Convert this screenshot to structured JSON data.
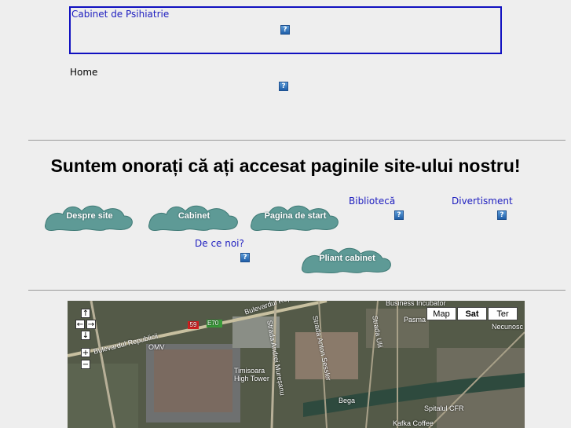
{
  "top": {
    "cabinet_link": "Cabinet de Psihiatrie",
    "home_link": "Home"
  },
  "headline": "Suntem onorați că ați accesat paginile site-ului nostru!",
  "nav": {
    "despre_site": "Despre site",
    "cabinet": "Cabinet",
    "pagina_start": "Pagina de start",
    "biblioteca": "Bibliotecă",
    "divertisment": "Divertisment",
    "de_ce_noi": "De ce noi?",
    "pliant": "Pliant cabinet"
  },
  "broken_image_glyph": "?",
  "map": {
    "type_buttons": {
      "map": "Map",
      "sat": "Sat",
      "ter": "Ter"
    },
    "labels": {
      "bulevardul_republicii_top": "Bulevardul Republicii",
      "bulevardul_republicii_left": "Bulevardul Republicii",
      "omv": "OMV",
      "timisoara_tower": "Timisoara High Tower",
      "strada_andrei": "Strada Andrei Mureșanu",
      "strada_anton": "Strada Anton Sessler",
      "strada_ulii": "Strada Ulii",
      "pasma": "Pasma",
      "bega": "Bega",
      "spitalul_cfr": "Spitalul CFR",
      "kafka": "Kafka Coffee",
      "business": "Business Incubator",
      "necunos": "Necunosc",
      "road_59": "59",
      "road_e70": "E70"
    }
  },
  "colors": {
    "background": "#eeeeee",
    "link": "#2020c0",
    "box_border": "#1010c0",
    "blob": "#5e9a96"
  }
}
